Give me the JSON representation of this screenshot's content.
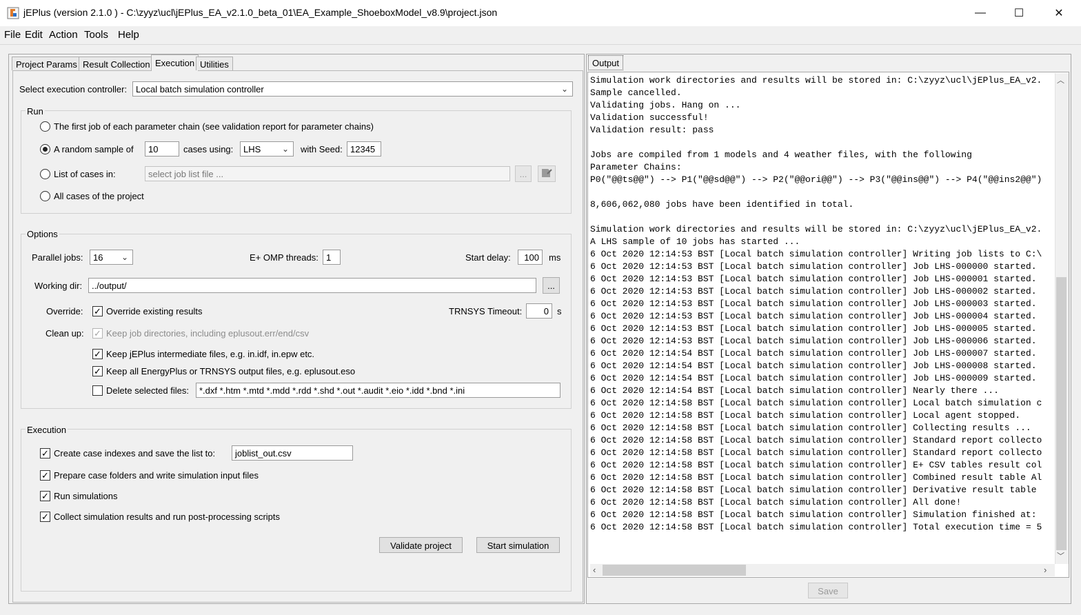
{
  "window": {
    "title": "jEPlus (version 2.1.0 )  - C:\\zyyz\\ucl\\jEPlus_EA_v2.1.0_beta_01\\EA_Example_ShoeboxModel_v8.9\\project.json",
    "minimize": "—",
    "maximize": "☐",
    "close": "✕"
  },
  "menu": [
    "File",
    "Edit",
    "Action",
    "Tools",
    "Help"
  ],
  "tabs": [
    "Project Params",
    "Result Collection",
    "Execution",
    "Utilities"
  ],
  "controller": {
    "label": "Select execution controller:",
    "value": "Local batch simulation controller"
  },
  "run": {
    "title": "Run",
    "first_job": "The first job of each parameter chain (see validation report for parameter chains)",
    "random_sample": "A random sample of",
    "sample_size": "10",
    "cases_using": "cases using:",
    "method": "LHS",
    "with_seed": "with Seed:",
    "seed": "12345",
    "list_of_cases": "List of cases in:",
    "job_list_placeholder": "select job list file ...",
    "browse": "...",
    "all_cases": "All cases of the project"
  },
  "options": {
    "title": "Options",
    "parallel_jobs_label": "Parallel jobs:",
    "parallel_jobs": "16",
    "omp_label": "E+ OMP threads:",
    "omp_threads": "1",
    "start_delay_label": "Start delay:",
    "start_delay": "100",
    "start_delay_unit": "ms",
    "working_dir_label": "Working dir:",
    "working_dir": "../output/",
    "browse": "...",
    "override_label": "Override:",
    "override_text": "Override existing results",
    "trnsys_label": "TRNSYS Timeout:",
    "trnsys_timeout": "0",
    "trnsys_unit": "s",
    "cleanup_label": "Clean up:",
    "keep_job_dirs": "Keep job directories, including eplusout.err/end/csv",
    "keep_intermediate": "Keep jEPlus intermediate files, e.g. in.idf, in.epw etc.",
    "keep_output": "Keep all EnergyPlus or TRNSYS output files, e.g. eplusout.eso",
    "delete_selected": "Delete selected files:",
    "delete_pattern": "*.dxf *.htm *.mtd *.mdd *.rdd *.shd *.out *.audit *.eio *.idd *.bnd *.ini"
  },
  "execution": {
    "title": "Execution",
    "create_indexes": "Create case indexes and save the list to:",
    "joblist_file": "joblist_out.csv",
    "prepare_folders": "Prepare case folders and write simulation input files",
    "run_simulations": "Run simulations",
    "collect_results": "Collect simulation results and run post-processing scripts",
    "validate_button": "Validate project",
    "start_button": "Start simulation"
  },
  "output": {
    "tab": "Output",
    "save_button": "Save",
    "lines": [
      "Simulation work directories and results will be stored in: C:\\zyyz\\ucl\\jEPlus_EA_v2.",
      "Sample cancelled.",
      "Validating jobs. Hang on ...",
      "Validation successful!",
      "Validation result: pass",
      "",
      "Jobs are compiled from 1 models and 4 weather files, with the following",
      "Parameter Chains:",
      "P0(\"@@ts@@\") --> P1(\"@@sd@@\") --> P2(\"@@ori@@\") --> P3(\"@@ins@@\") --> P4(\"@@ins2@@\")",
      "",
      "8,606,062,080 jobs have been identified in total.",
      "",
      "Simulation work directories and results will be stored in: C:\\zyyz\\ucl\\jEPlus_EA_v2.",
      "A LHS sample of 10 jobs has started ...",
      "6 Oct 2020 12:14:53 BST [Local batch simulation controller] Writing job lists to C:\\",
      "6 Oct 2020 12:14:53 BST [Local batch simulation controller] Job LHS-000000 started.",
      "6 Oct 2020 12:14:53 BST [Local batch simulation controller] Job LHS-000001 started.",
      "6 Oct 2020 12:14:53 BST [Local batch simulation controller] Job LHS-000002 started.",
      "6 Oct 2020 12:14:53 BST [Local batch simulation controller] Job LHS-000003 started.",
      "6 Oct 2020 12:14:53 BST [Local batch simulation controller] Job LHS-000004 started.",
      "6 Oct 2020 12:14:53 BST [Local batch simulation controller] Job LHS-000005 started.",
      "6 Oct 2020 12:14:53 BST [Local batch simulation controller] Job LHS-000006 started.",
      "6 Oct 2020 12:14:54 BST [Local batch simulation controller] Job LHS-000007 started.",
      "6 Oct 2020 12:14:54 BST [Local batch simulation controller] Job LHS-000008 started.",
      "6 Oct 2020 12:14:54 BST [Local batch simulation controller] Job LHS-000009 started.",
      "6 Oct 2020 12:14:54 BST [Local batch simulation controller] Nearly there ...",
      "6 Oct 2020 12:14:58 BST [Local batch simulation controller] Local batch simulation c",
      "6 Oct 2020 12:14:58 BST [Local batch simulation controller] Local agent stopped.",
      "6 Oct 2020 12:14:58 BST [Local batch simulation controller] Collecting results ...",
      "6 Oct 2020 12:14:58 BST [Local batch simulation controller] Standard report collecto",
      "6 Oct 2020 12:14:58 BST [Local batch simulation controller] Standard report collecto",
      "6 Oct 2020 12:14:58 BST [Local batch simulation controller] E+ CSV tables result col",
      "6 Oct 2020 12:14:58 BST [Local batch simulation controller] Combined result table Al",
      "6 Oct 2020 12:14:58 BST [Local batch simulation controller] Derivative result table",
      "6 Oct 2020 12:14:58 BST [Local batch simulation controller] All done!",
      "6 Oct 2020 12:14:58 BST [Local batch simulation controller] Simulation finished at:",
      "6 Oct 2020 12:14:58 BST [Local batch simulation controller] Total execution time = 5"
    ]
  }
}
